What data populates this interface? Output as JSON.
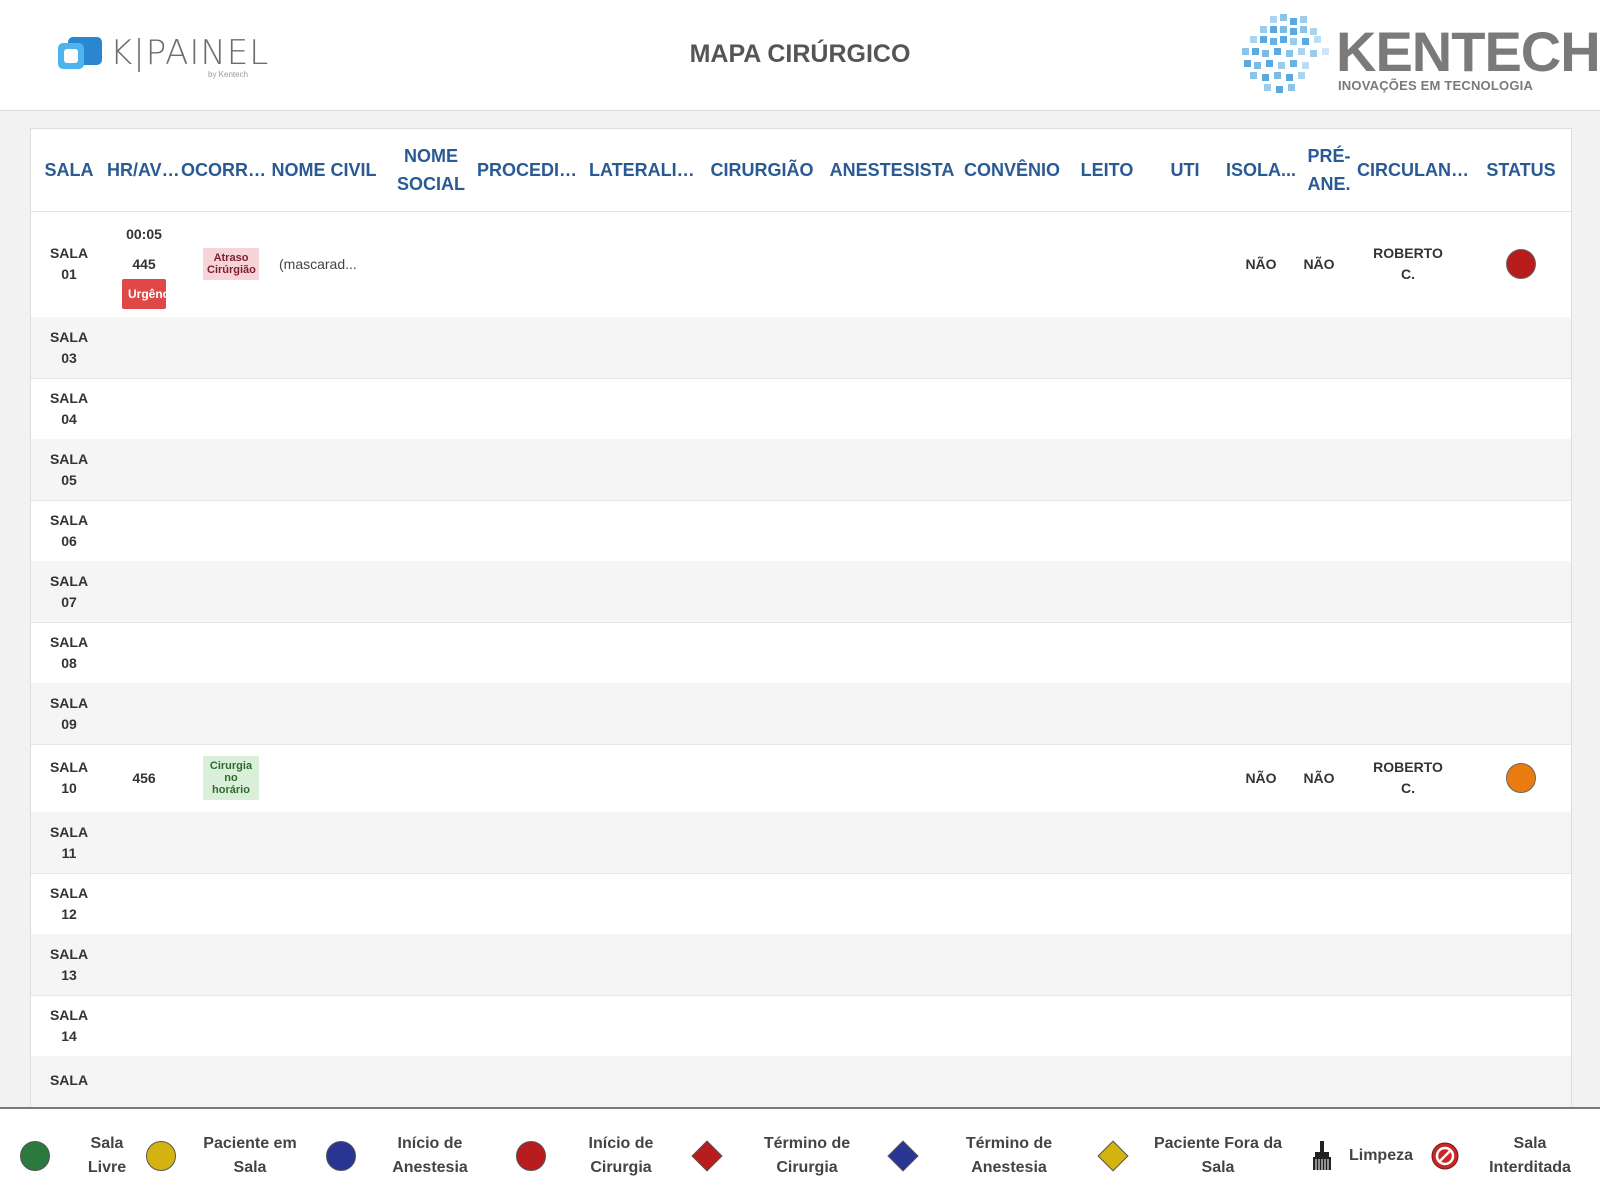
{
  "header": {
    "app_logo_text": "K|PAINEL",
    "app_logo_sub": "by Kentech",
    "title": "MAPA CIRÚRGICO",
    "brand_name": "KENTECH",
    "brand_tagline": "INOVAÇÕES EM TECNOLOGIA"
  },
  "columns": {
    "sala": "SALA",
    "hr": "HR/AVI...",
    "ocorrencia": "OCORRÊ...",
    "nome_civil": "NOME CIVIL",
    "nome_social": "NOME SOCIAL",
    "procedimento": "PROCEDIM...",
    "lateralidade": "LATERALID...",
    "cirurgiao": "CIRURGIÃO",
    "anestesista": "ANESTESISTA",
    "convenio": "CONVÊNIO",
    "leito": "LEITO",
    "uti": "UTI",
    "isolamento": "ISOLA...",
    "pre_ane": "PRÉ-ANE.",
    "circulante": "CIRCULANTE",
    "status": "STATUS"
  },
  "rows": [
    {
      "sala": "SALA 01",
      "hr_time": "00:05",
      "aviso": "445",
      "urgency": "Urgência",
      "ocorrencia": "Atraso Cirúrgião",
      "nome_civil": "(mascarad...",
      "isolamento": "NÃO",
      "pre_ane": "NÃO",
      "circulante": "ROBERTO C.",
      "status_color": "#b81c1c"
    },
    {
      "sala": "SALA 03"
    },
    {
      "sala": "SALA 04"
    },
    {
      "sala": "SALA 05"
    },
    {
      "sala": "SALA 06"
    },
    {
      "sala": "SALA 07"
    },
    {
      "sala": "SALA 08"
    },
    {
      "sala": "SALA 09"
    },
    {
      "sala": "SALA 10",
      "aviso": "456",
      "ocorrencia": "Cirurgia no horário",
      "isolamento": "NÃO",
      "pre_ane": "NÃO",
      "circulante": "ROBERTO C.",
      "status_color": "#ea7b0f"
    },
    {
      "sala": "SALA 11"
    },
    {
      "sala": "SALA 12"
    },
    {
      "sala": "SALA 13"
    },
    {
      "sala": "SALA 14"
    },
    {
      "sala": "SALA"
    }
  ],
  "legend": [
    {
      "label": "Sala Livre",
      "icon": "circle-icon",
      "color": "#2a7a3e"
    },
    {
      "label": "Paciente em Sala",
      "icon": "circle-icon",
      "color": "#d4b20f"
    },
    {
      "label": "Início de Anestesia",
      "icon": "circle-icon",
      "color": "#283593"
    },
    {
      "label": "Início de Cirurgia",
      "icon": "circle-icon",
      "color": "#b81c1c"
    },
    {
      "label": "Término de Cirurgia",
      "icon": "diamond-icon",
      "color": "#b81c1c"
    },
    {
      "label": "Término de Anestesia",
      "icon": "diamond-icon",
      "color": "#283593"
    },
    {
      "label": "Paciente Fora da Sala",
      "icon": "diamond-icon",
      "color": "#d4b20f"
    },
    {
      "label": "Limpeza",
      "icon": "broom-icon",
      "color": "#222222"
    },
    {
      "label": "Sala Interditada",
      "icon": "prohibited-icon",
      "color": "#c62828"
    }
  ]
}
